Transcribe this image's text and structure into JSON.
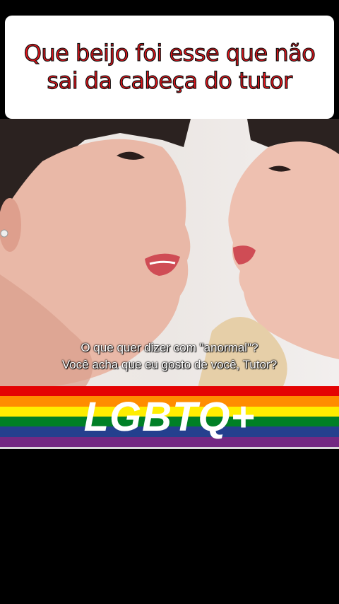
{
  "caption": {
    "text": "Que beijo foi esse que não sai da cabeça do tutor",
    "color": "#e5141b"
  },
  "video": {
    "subtitle_line1": "O que quer dizer com \"anormal\"?",
    "subtitle_line2": "Você acha que eu gosto de você, Tutor?"
  },
  "banner": {
    "text": "LGBTQ+",
    "stripe_colors": [
      "#e40303",
      "#ff8c00",
      "#ffed00",
      "#008026",
      "#24408e",
      "#732982"
    ]
  }
}
